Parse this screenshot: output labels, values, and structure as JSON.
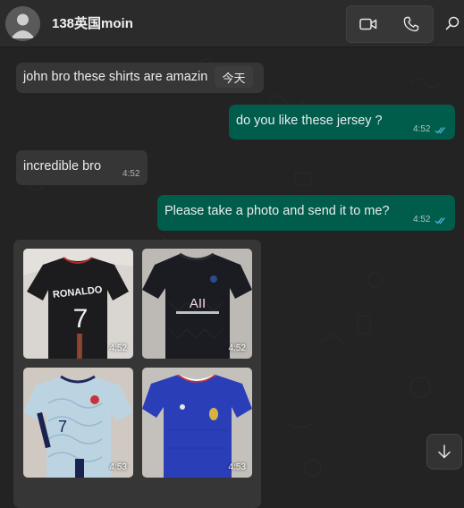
{
  "contact": {
    "name": "138英国moin"
  },
  "header": {
    "video_icon": "video-camera-icon",
    "call_icon": "phone-icon",
    "search_icon": "search-icon"
  },
  "messages": [
    {
      "direction": "incoming",
      "text": "john bro these shirts are amazin"
    },
    {
      "direction": "outgoing",
      "text": "do  you like  these  jersey ?",
      "time": "4:52",
      "status": "read"
    },
    {
      "direction": "incoming",
      "text": "incredible bro",
      "time": "4:52"
    },
    {
      "direction": "outgoing",
      "text": "Please take a photo and send it to me?",
      "time": "4:52",
      "status": "read"
    }
  ],
  "date_chip": "今天",
  "album": {
    "photos": [
      {
        "time": "4:52",
        "jersey_text": "RONALDO",
        "jersey_number": "7"
      },
      {
        "time": "4:52",
        "jersey_text": "AII"
      },
      {
        "time": "4:53",
        "jersey_number": "7"
      },
      {
        "time": "4:53"
      }
    ]
  },
  "scroll_button_icon": "arrow-down-icon",
  "colors": {
    "outgoing_bubble": "#005c4b",
    "incoming_bubble": "#363636",
    "read_ticks": "#53bdeb"
  }
}
